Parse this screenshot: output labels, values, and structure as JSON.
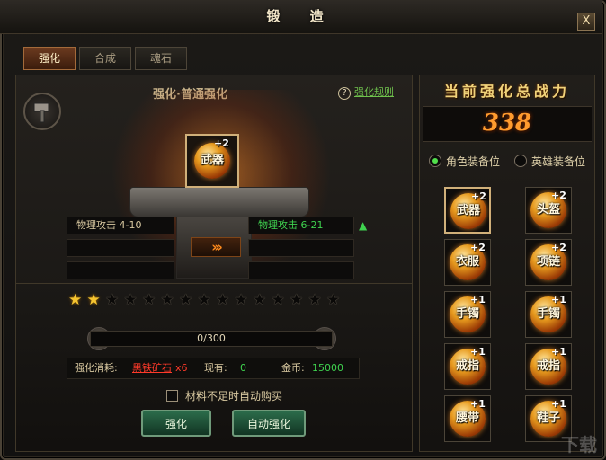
{
  "window": {
    "title": "锻 造",
    "close_label": "X"
  },
  "tabs": [
    {
      "label": "强化",
      "active": true
    },
    {
      "label": "合成",
      "active": false
    },
    {
      "label": "魂石",
      "active": false
    }
  ],
  "forge": {
    "section_title": "强化·普通强化",
    "rules_link": "强化规则",
    "rules_icon": "?",
    "target_item": {
      "name": "武器",
      "level": "+2"
    },
    "current_stat": "物理攻击  4-10",
    "next_stat": "物理攻击  6-21",
    "arrow_glyph": "›››",
    "up_glyph": "▲",
    "stars": {
      "filled": 2,
      "total": 15
    },
    "progress": {
      "text": "0/300",
      "fraction": 0
    },
    "cost": {
      "label": "强化消耗:",
      "material": "黑铁矿石",
      "material_qty": "x6",
      "owned_label": "现有:",
      "owned_value": "0",
      "gold_label": "金币:",
      "gold_value": "15000"
    },
    "auto_buy_label": "材料不足时自动购买",
    "buttons": {
      "strengthen": "强化",
      "auto_strengthen": "自动强化"
    }
  },
  "power": {
    "title": "当前强化总战力",
    "value": "338",
    "options": [
      {
        "label": "角色装备位",
        "selected": true
      },
      {
        "label": "英雄装备位",
        "selected": false
      }
    ]
  },
  "equipment": [
    {
      "name": "武器",
      "level": "+2",
      "selected": true
    },
    {
      "name": "头盔",
      "level": "+2",
      "selected": false
    },
    {
      "name": "衣服",
      "level": "+2",
      "selected": false
    },
    {
      "name": "项链",
      "level": "+2",
      "selected": false
    },
    {
      "name": "手镯",
      "level": "+1",
      "selected": false
    },
    {
      "name": "手镯",
      "level": "+1",
      "selected": false
    },
    {
      "name": "戒指",
      "level": "+1",
      "selected": false
    },
    {
      "name": "戒指",
      "level": "+1",
      "selected": false
    },
    {
      "name": "腰带",
      "level": "+1",
      "selected": false
    },
    {
      "name": "鞋子",
      "level": "+1",
      "selected": false
    }
  ],
  "colors": {
    "accent_gold": "#f0d27a",
    "power_orange": "#ff9b2e",
    "stat_green": "#3fd24f",
    "material_red": "#ff3a2a"
  },
  "icons": {
    "hammer": "hammer-icon",
    "close": "close-icon",
    "arrow": "triple-chevron-right-icon",
    "up": "up-arrow-icon"
  },
  "watermark": "下载"
}
